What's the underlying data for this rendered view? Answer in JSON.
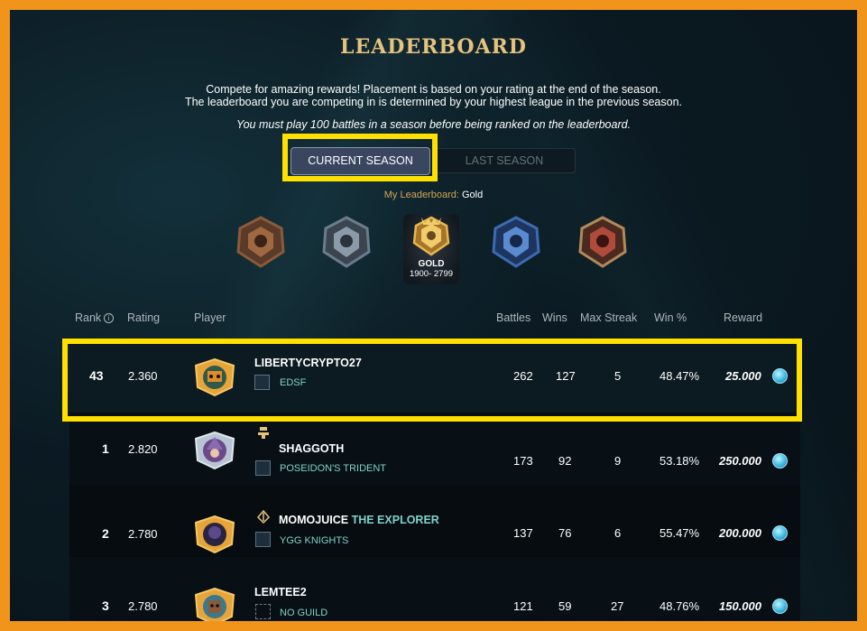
{
  "header": {
    "title": "LEADERBOARD",
    "desc_line1": "Compete for amazing rewards! Placement is based on your rating at the end of the season.",
    "desc_line2": "The leaderboard you are competing in is determined by your highest league in the previous season.",
    "note": "You must play 100 battles in a season before being ranked on the leaderboard."
  },
  "tabs": {
    "current": "CURRENT SEASON",
    "last": "LAST SEASON",
    "selected": "current"
  },
  "my_leaderboard": {
    "label": "My Leaderboard:",
    "value": "Gold"
  },
  "leagues": [
    {
      "name": "bronze",
      "color": "#8a5a3c"
    },
    {
      "name": "silver",
      "color": "#6b7c8c"
    },
    {
      "name": "gold",
      "label": "GOLD",
      "range": "1900- 2799",
      "color": "#d9a441"
    },
    {
      "name": "diamond",
      "color": "#3b6bb0"
    },
    {
      "name": "champion",
      "color": "#b04a3a"
    }
  ],
  "columns": {
    "rank": "Rank",
    "rating": "Rating",
    "player": "Player",
    "battles": "Battles",
    "wins": "Wins",
    "max_streak": "Max Streak",
    "win_pct": "Win %",
    "reward": "Reward"
  },
  "rows": [
    {
      "rank": "43",
      "rating": "2.360",
      "player": "LIBERTYCRYPTO27",
      "title": "",
      "guild": "EDSF",
      "battles": "262",
      "wins": "127",
      "max_streak": "5",
      "win_pct": "48.47%",
      "reward": "25.000"
    },
    {
      "rank": "1",
      "rating": "2.820",
      "player": "SHAGGOTH",
      "title": "",
      "guild": "POSEIDON'S TRIDENT",
      "battles": "173",
      "wins": "92",
      "max_streak": "9",
      "win_pct": "53.18%",
      "reward": "250.000"
    },
    {
      "rank": "2",
      "rating": "2.780",
      "player": "MOMOJUICE",
      "title": "THE EXPLORER",
      "guild": "YGG KNIGHTS",
      "battles": "137",
      "wins": "76",
      "max_streak": "6",
      "win_pct": "55.47%",
      "reward": "200.000"
    },
    {
      "rank": "3",
      "rating": "2.780",
      "player": "LEMTEE2",
      "title": "",
      "guild": "NO GUILD",
      "battles": "121",
      "wins": "59",
      "max_streak": "27",
      "win_pct": "48.76%",
      "reward": "150.000"
    }
  ],
  "colors": {
    "accent_gold": "#e6c27f",
    "highlight": "#ffe000",
    "border": "#f0941c",
    "guild_text": "#7fd3c8"
  }
}
